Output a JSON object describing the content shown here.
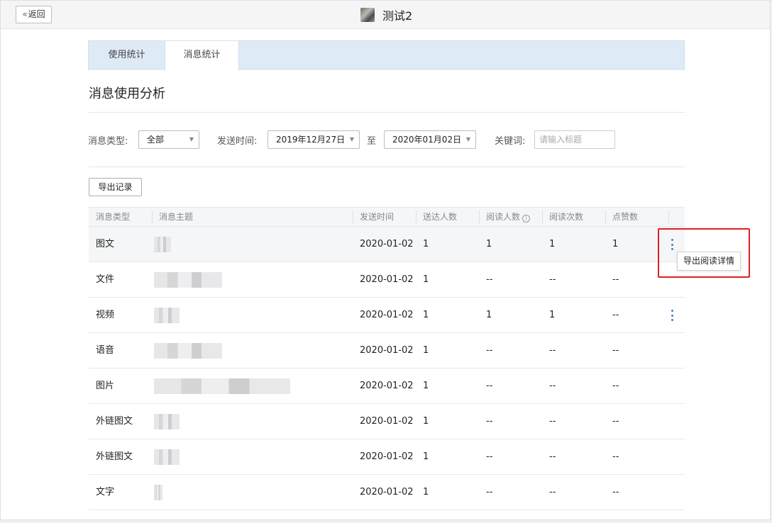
{
  "topbar": {
    "back_label": "返回",
    "chat_name": "测试2"
  },
  "tabs": [
    {
      "label": "使用统计",
      "active": false
    },
    {
      "label": "消息统计",
      "active": true
    }
  ],
  "section_title": "消息使用分析",
  "filters": {
    "type_label": "消息类型:",
    "type_value": "全部",
    "time_label": "发送时间:",
    "start_date": "2019年12月27日",
    "to_label": "至",
    "end_date": "2020年01月02日",
    "keyword_label": "关键词:",
    "keyword_placeholder": "请输入标题"
  },
  "export_label": "导出记录",
  "table": {
    "columns": [
      "消息类型",
      "消息主题",
      "发送时间",
      "送达人数",
      "阅读人数",
      "阅读次数",
      "点赞数"
    ],
    "rows": [
      {
        "type": "图文",
        "time": "2020-01-02",
        "delivered": "1",
        "readers": "1",
        "reads": "1",
        "likes": "1",
        "menu": true
      },
      {
        "type": "文件",
        "time": "2020-01-02",
        "delivered": "1",
        "readers": "--",
        "reads": "--",
        "likes": "--",
        "menu": false
      },
      {
        "type": "视频",
        "time": "2020-01-02",
        "delivered": "1",
        "readers": "1",
        "reads": "1",
        "likes": "--",
        "menu": true
      },
      {
        "type": "语音",
        "time": "2020-01-02",
        "delivered": "1",
        "readers": "--",
        "reads": "--",
        "likes": "--",
        "menu": false
      },
      {
        "type": "图片",
        "time": "2020-01-02",
        "delivered": "1",
        "readers": "--",
        "reads": "--",
        "likes": "--",
        "menu": false
      },
      {
        "type": "外链图文",
        "time": "2020-01-02",
        "delivered": "1",
        "readers": "--",
        "reads": "--",
        "likes": "--",
        "menu": false
      },
      {
        "type": "外链图文",
        "time": "2020-01-02",
        "delivered": "1",
        "readers": "--",
        "reads": "--",
        "likes": "--",
        "menu": false
      },
      {
        "type": "文字",
        "time": "2020-01-02",
        "delivered": "1",
        "readers": "--",
        "reads": "--",
        "likes": "--",
        "menu": false
      }
    ]
  },
  "tooltip_label": "导出阅读详情",
  "colors": {
    "accent": "#3b7fd6",
    "highlight_border": "#e02020",
    "tab_bar": "#dfeaf7"
  }
}
